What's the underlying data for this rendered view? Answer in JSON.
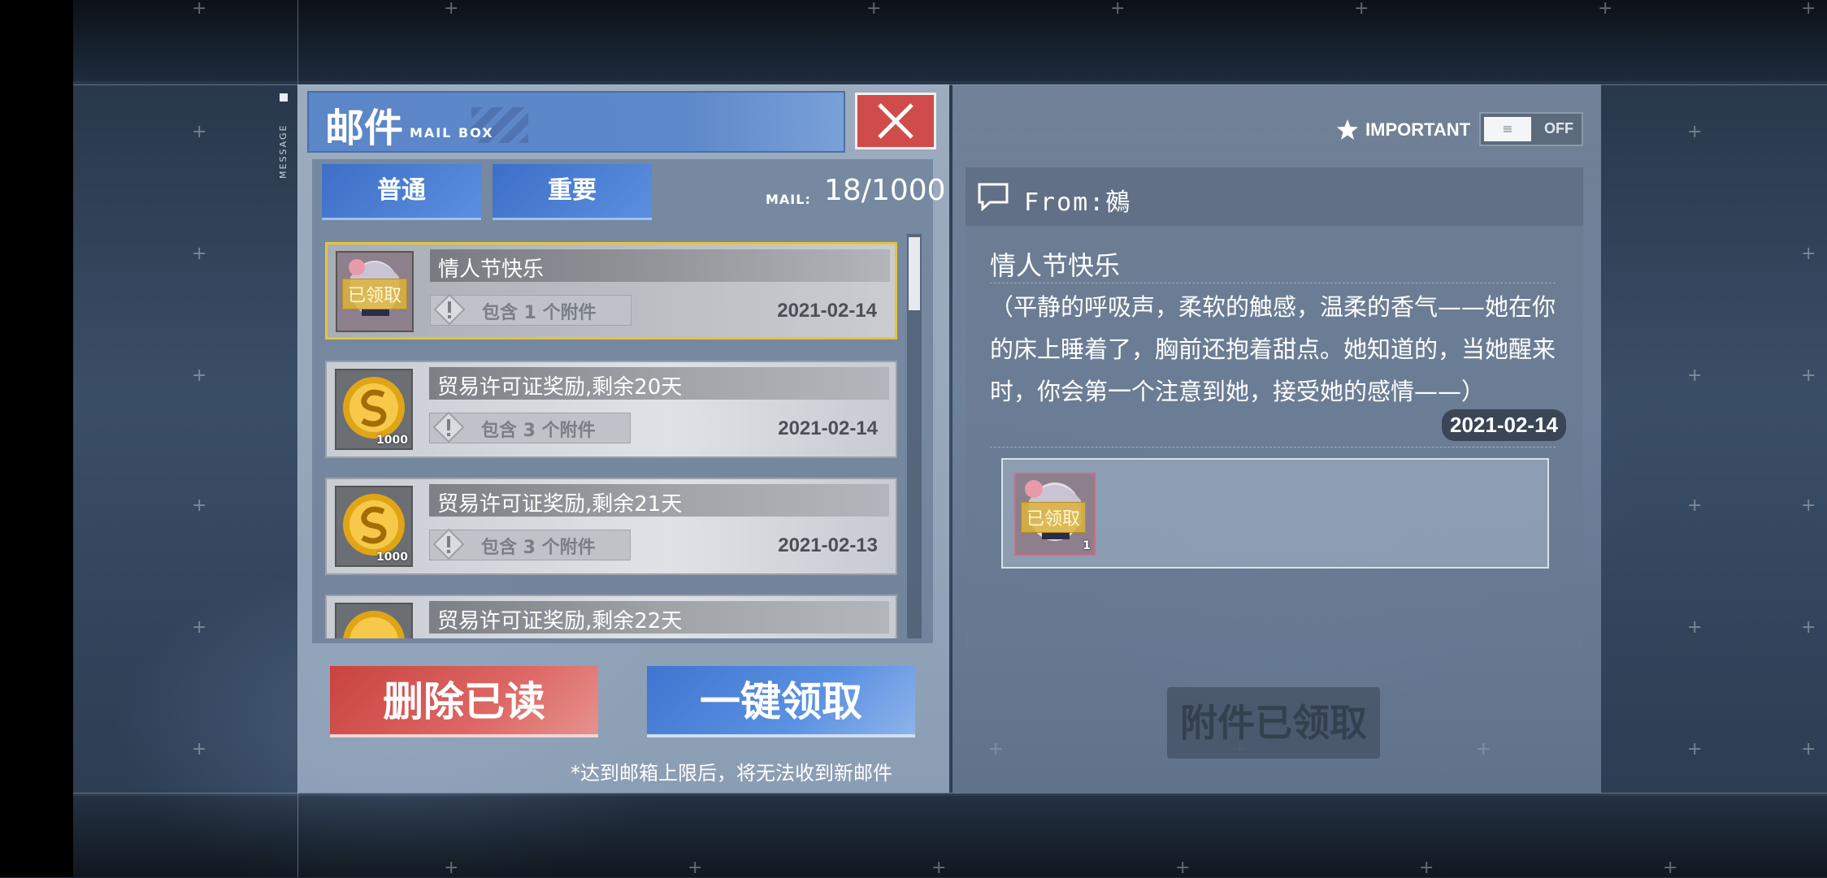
{
  "side_label": "MESSAGE",
  "header": {
    "title": "邮件",
    "subtitle": "MAIL BOX",
    "close_icon": "close-icon"
  },
  "tabs": [
    {
      "label": "普通"
    },
    {
      "label": "重要"
    }
  ],
  "mail_count": {
    "label": "MAIL:",
    "value": "18/1000"
  },
  "mails": [
    {
      "title": "情人节快乐",
      "attachments": "包含 1 个附件",
      "date": "2021-02-14",
      "icon": "character-portrait-icon",
      "claimed_tag": "已领取",
      "selected": true
    },
    {
      "title": "贸易许可证奖励,剩余20天",
      "attachments": "包含 3 个附件",
      "date": "2021-02-14",
      "icon": "gold-coin-icon",
      "count": "1000"
    },
    {
      "title": "贸易许可证奖励,剩余21天",
      "attachments": "包含 3 个附件",
      "date": "2021-02-13",
      "icon": "gold-coin-icon",
      "count": "1000"
    },
    {
      "title": "贸易许可证奖励,剩余22天",
      "icon": "gold-coin-icon"
    }
  ],
  "actions": {
    "delete_read": "删除已读",
    "claim_all": "一键领取"
  },
  "footnote": "*达到邮箱上限后，将无法收到新邮件",
  "important_filter": {
    "label": "IMPORTANT",
    "state": "OFF",
    "icon": "star-icon"
  },
  "detail": {
    "from": "From:鵺",
    "title": "情人节快乐",
    "body": "（平静的呼吸声，柔软的触感，温柔的香气——她在你的床上睡着了，胸前还抱着甜点。她知道的，当她醒来时，你会第一个注意到她，接受她的感情——）",
    "date": "2021-02-14",
    "attachment": {
      "icon": "character-portrait-icon",
      "claimed_tag": "已领取",
      "count": "1"
    },
    "claimed_button": "附件已领取"
  },
  "colors": {
    "accent_blue": "#4a7fd3",
    "danger_red": "#d04c4a",
    "highlight_gold": "#e5c43b"
  }
}
